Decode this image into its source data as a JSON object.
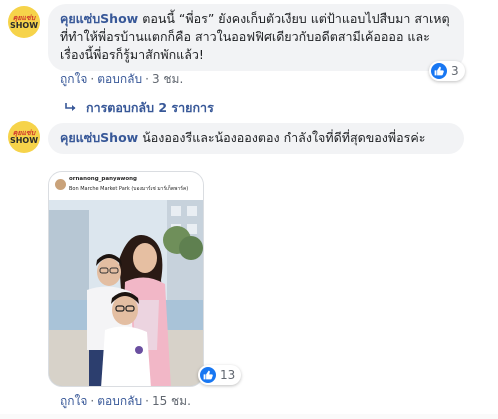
{
  "comment1": {
    "author": "คุยแซ่บShow",
    "text": "ตอนนี้ “พี่อร” ยังคงเก็บตัวเงียบ แต่ป้าแอบไปสืบมา สาเหตุที่ทำให้พี่อรบ้านแตกก็คือ สาวในออฟฟิศเดียวกับอดีตสามีเค้ออออ และเรื่องนี้พี่อรก็รู้มาสักพักแล้ว!",
    "like_label": "ถูกใจ",
    "reply_label": "ตอบกลับ",
    "time": "3 ชม.",
    "reaction_count": "3",
    "replies_link": "การตอบกลับ 2 รายการ"
  },
  "comment2": {
    "author": "คุยแซ่บShow",
    "text": "น้องอองรีและน้องอองตอง กำลังใจที่ดีที่สุดของพี่อรค่ะ",
    "photo_username": "ornanong_panyawong",
    "photo_location": "Bon Marche Market Park (บองมาร์เช่ มาร์เก็ตพาร์ค)",
    "like_label": "ถูกใจ",
    "reply_label": "ตอบกลับ",
    "time": "15 ชม.",
    "reaction_count": "13"
  },
  "avatar": {
    "line1": "คุยแซ่บ",
    "line2": "SHOW"
  },
  "colors": {
    "link": "#385898",
    "bubble": "#f2f3f5",
    "like": "#1877f2",
    "avatar": "#f6d34a"
  },
  "icons": [
    "like-icon",
    "reply-arrow-icon"
  ]
}
